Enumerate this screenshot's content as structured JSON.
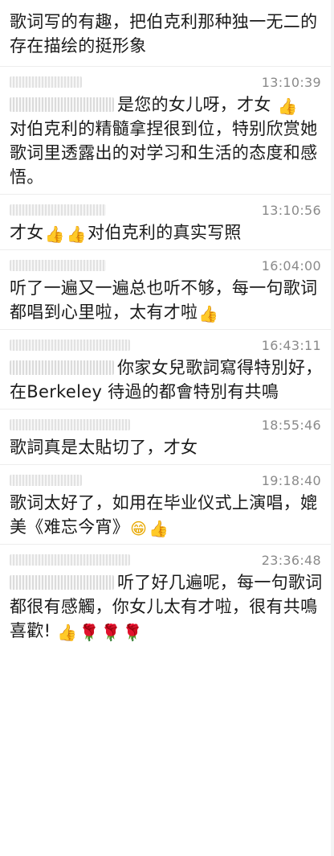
{
  "intro": {
    "text": "歌词写的有趣，把伯克利那种独一无二的存在描绘的挺形象"
  },
  "comments": [
    {
      "time": "13:10:39",
      "text_line": "是您的女儿呀，才女",
      "emoji_after": "thumbs-up",
      "text_rest": "对伯克利的精髓拿捏很到位，特别欣赏她歌词里透露出的对学习和生活的态度和感悟。"
    },
    {
      "time": "13:10:56",
      "prefix": "才女",
      "text": "对伯克利的真实写照"
    },
    {
      "time": "16:04:00",
      "text": "听了一遍又一遍总也听不够，每一句歌词都唱到心里啦，太有才啦"
    },
    {
      "time": "16:43:11",
      "text": "你家女兒歌詞寫得特別好，在Berkeley 待過的都會特別有共鳴"
    },
    {
      "time": "18:55:46",
      "text": "歌詞真是太貼切了，才女"
    },
    {
      "time": "19:18:40",
      "text": "歌词太好了，如用在毕业仪式上演唱，媲美《难忘今宵》"
    },
    {
      "time": "23:36:48",
      "text": "听了好几遍呢，每一句歌词都很有感觸，你女儿太有才啦，很有共鳴 喜歡!"
    }
  ],
  "icons": {
    "thumbs_up": "👍",
    "grin": "😁",
    "rose": "🌹"
  }
}
